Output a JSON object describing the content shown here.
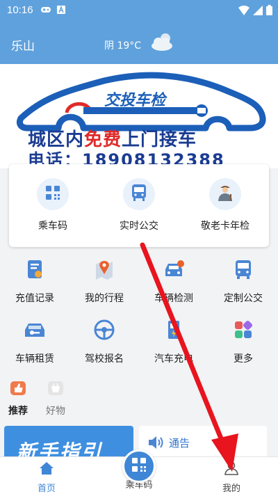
{
  "status_bar": {
    "time": "10:16"
  },
  "header": {
    "city": "乐山",
    "weather": "阴 19°C"
  },
  "banner": {
    "title": "交投车检",
    "line1_pre": "城区内",
    "line1_highlight": "免费",
    "line1_post": "上门接车",
    "line2": "电话：18908132388"
  },
  "main_card": [
    {
      "label": "乘车码",
      "icon": "qr-code-icon"
    },
    {
      "label": "实时公交",
      "icon": "bus-icon"
    },
    {
      "label": "敬老卡年检",
      "icon": "elderly-person-icon"
    }
  ],
  "grid": [
    {
      "label": "充值记录",
      "icon": "recharge-record-icon"
    },
    {
      "label": "我的行程",
      "icon": "map-pin-icon"
    },
    {
      "label": "车辆检测",
      "icon": "car-inspection-icon"
    },
    {
      "label": "定制公交",
      "icon": "custom-bus-icon"
    },
    {
      "label": "车辆租赁",
      "icon": "car-rental-icon"
    },
    {
      "label": "驾校报名",
      "icon": "steering-wheel-icon"
    },
    {
      "label": "汽车充电",
      "icon": "charging-station-icon"
    },
    {
      "label": "更多",
      "icon": "more-apps-icon"
    }
  ],
  "tabs": [
    {
      "label": "推荐",
      "icon": "thumbs-up-icon"
    },
    {
      "label": "好物",
      "icon": "shop-basket-icon"
    }
  ],
  "promo": {
    "text": "新手指引"
  },
  "notice": {
    "label": "通告"
  },
  "bottom_nav": [
    {
      "label": "首页",
      "icon": "home-icon"
    },
    {
      "label": "乘车码",
      "icon": "qr-code-icon"
    },
    {
      "label": "我的",
      "icon": "user-icon"
    }
  ],
  "colors": {
    "primary": "#5fa1dc",
    "accent_red": "#e02a2a",
    "arrow_red": "#e8141e"
  }
}
